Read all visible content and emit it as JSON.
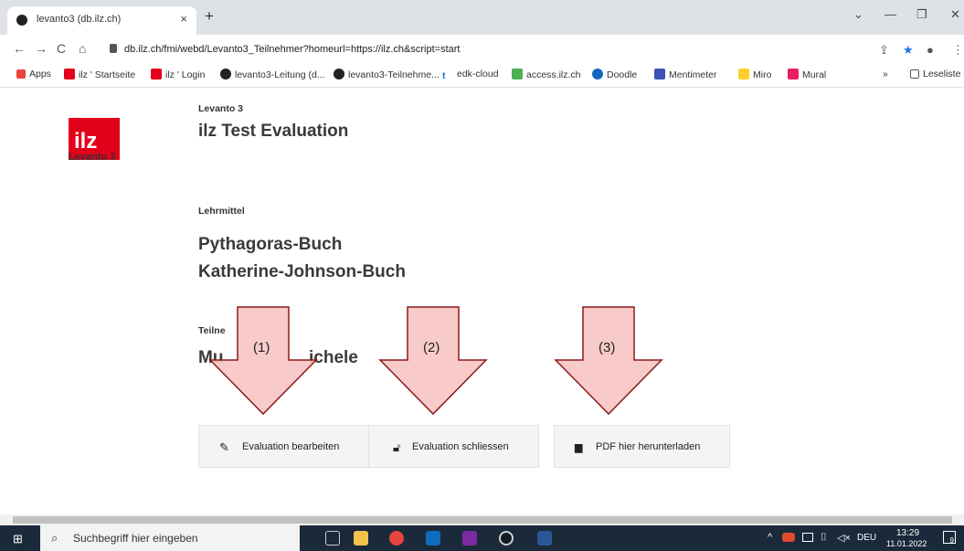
{
  "browser": {
    "tab_title": "levanto3 (db.ilz.ch)",
    "tab_close": "×",
    "new_tab": "+",
    "url": "db.ilz.ch/fmi/webd/Levanto3_Teilnehmer?homeurl=https://ilz.ch&script=start",
    "bookmarks": [
      {
        "label": "Apps",
        "color": "#e8453c"
      },
      {
        "label": "ilz ' Startseite",
        "color": "#e3001b"
      },
      {
        "label": "ilz ' Login",
        "color": "#e3001b"
      },
      {
        "label": "levanto3-Leitung (d...",
        "color": "#222222"
      },
      {
        "label": "levanto3-Teilnehme...",
        "color": "#222222"
      },
      {
        "label": "edk-cloud",
        "color": "#1a73e8"
      },
      {
        "label": "access.ilz.ch",
        "color": "#4caf50"
      },
      {
        "label": "Doodle",
        "color": "#1565c0"
      },
      {
        "label": "Mentimeter",
        "color": "#3f51b5"
      },
      {
        "label": "Miro",
        "color": "#ffd02f"
      },
      {
        "label": "Mural",
        "color": "#e91e63"
      }
    ],
    "more": "»",
    "reading_list": "Leseliste"
  },
  "page": {
    "logo_text": "ilz",
    "logo_sub": "Levanto 3",
    "app_label": "Levanto 3",
    "title": "ilz Test Evaluation",
    "lehrmittel_label": "Lehrmittel",
    "lehrmittel": [
      "Pythagoras-Buch",
      "Katherine-Johnson-Buch"
    ],
    "teilnehmer_label": "Teilne",
    "teilnehmer_name": "Mu",
    "teilnehmer_name_end": "ichele",
    "buttons": {
      "edit": "Evaluation bearbeiten",
      "close": "Evaluation schliessen",
      "pdf": "PDF hier herunterladen"
    },
    "annotations": [
      "(1)",
      "(2)",
      "(3)"
    ]
  },
  "taskbar": {
    "search_placeholder": "Suchbegriff hier eingeben",
    "language": "DEU",
    "time": "13:29",
    "date": "11.01.2022",
    "notification_count": "9"
  }
}
